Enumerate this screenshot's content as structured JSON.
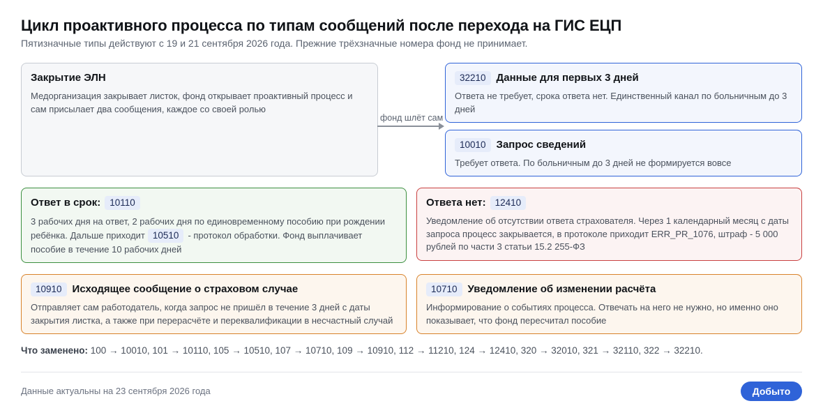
{
  "header": {
    "title": "Цикл проактивного процесса по типам сообщений после перехода на ГИС ЕЦП",
    "subtitle": "Пятизначные типы действуют с 19 и 21 сентября 2026 года. Прежние трёхзначные номера фонд не принимает."
  },
  "arrow": {
    "label": "фонд шлёт сам"
  },
  "cards": {
    "eln": {
      "title": "Закрытие ЭЛН",
      "text": "Медорганизация закрывает листок, фонд открывает проактивный процесс и сам присылает два сообщения, каждое со своей ролью"
    },
    "first_days": {
      "code": "32210",
      "title": "Данные для первых 3 дней",
      "text": "Ответа не требует, срока ответа нет. Единственный канал по больничным до 3 дней"
    },
    "request": {
      "code": "10010",
      "title": "Запрос сведений",
      "text": "Требует ответа. По больничным до 3 дней не формируется вовсе"
    },
    "answer_on_time": {
      "title": "Ответ в срок:",
      "code": "10110",
      "text_before": "3 рабочих дня на ответ, 2 рабочих дня по единовременному пособию при рождении ребёнка. Дальше приходит",
      "inline_code": "10510",
      "text_after": "- протокол обработки. Фонд выплачивает пособие в течение 10 рабочих дней"
    },
    "no_answer": {
      "title": "Ответа нет:",
      "code": "12410",
      "text": "Уведомление об отсутствии ответа страхователя. Через 1 календарный месяц с даты запроса процесс закрывается, в протоколе приходит ERR_PR_1076, штраф - 5 000 рублей по части 3 статьи 15.2 255-ФЗ"
    },
    "outgoing": {
      "code": "10910",
      "title": "Исходящее сообщение о страховом случае",
      "text": "Отправляет сам работодатель, когда запрос не пришёл в течение 3 дней с даты закрытия листка, а также при перерасчёте и переквалификации в несчастный случай"
    },
    "recalc": {
      "code": "10710",
      "title": "Уведомление об изменении расчёта",
      "text": "Информирование о событиях процесса. Отвечать на него не нужно, но именно оно показывает, что фонд пересчитал пособие"
    }
  },
  "replaced": {
    "label": "Что заменено:",
    "text": "100 → 10010, 101 → 10110, 105 → 10510, 107 → 10710, 109 → 10910, 112 → 11210, 124 → 12410, 320 → 32010, 321 → 32110, 322 → 32210."
  },
  "footer": {
    "text": "Данные актуальны на 23 сентября 2026 года",
    "button_label": "Добыто"
  },
  "colors": {
    "blue": "#2f63d8",
    "green": "#3b8f3f",
    "red": "#c94040",
    "orange": "#d8822a",
    "gray": "#c8ccd3"
  }
}
